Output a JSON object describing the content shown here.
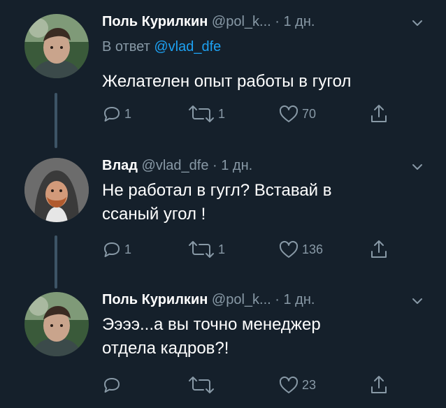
{
  "tweets": [
    {
      "name": "Поль Курилкин",
      "handle": "@pol_k...",
      "dot": "·",
      "time": "1 дн.",
      "reply_prefix": "В ответ ",
      "reply_mention": "@vlad_dfe",
      "text": "Желателен опыт работы в гугол",
      "replies": "1",
      "retweets": "1",
      "likes": "70"
    },
    {
      "name": "Влад",
      "handle": "@vlad_dfe",
      "dot": "·",
      "time": "1 дн.",
      "text_line1": "Не работал в гугл? Вставай в",
      "text_line2": "ссаный угол !",
      "replies": "1",
      "retweets": "1",
      "likes": "136"
    },
    {
      "name": "Поль Курилкин",
      "handle": "@pol_k...",
      "dot": "·",
      "time": "1 дн.",
      "text_line1": "Ээээ...а вы точно менеджер",
      "text_line2": "отдела кадров?!",
      "likes": "23"
    }
  ],
  "icons": {
    "reply": "reply-icon",
    "retweet": "retweet-icon",
    "like": "heart-icon",
    "share": "share-icon",
    "more": "chevron-down-icon"
  },
  "colors": {
    "background": "#15202b",
    "text": "#ffffff",
    "muted": "#8899a6",
    "link": "#1da1f2",
    "thread": "#3d5466"
  }
}
